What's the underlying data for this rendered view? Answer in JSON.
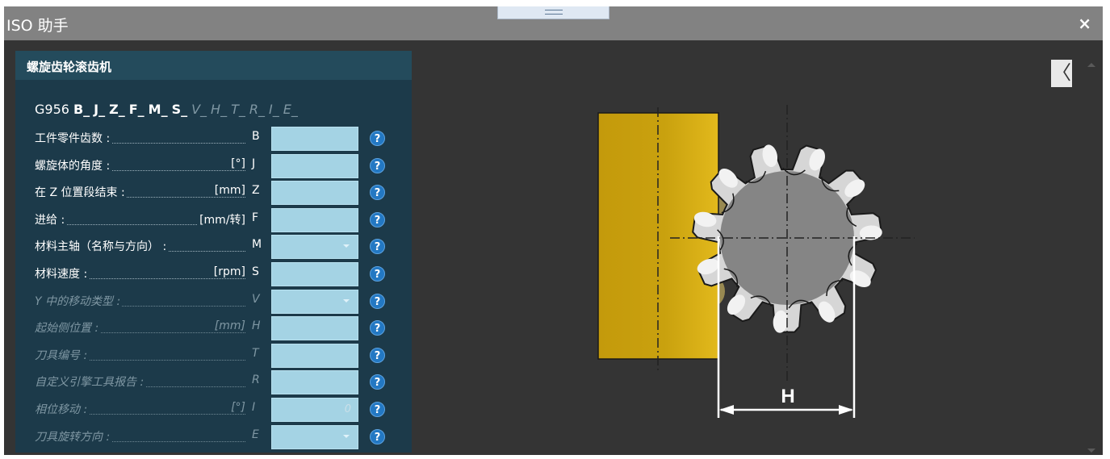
{
  "window": {
    "title": "ISO 助手",
    "close_symbol": "×"
  },
  "panel": {
    "title": "螺旋齿轮滚齿机",
    "code": {
      "prefix": "G956",
      "active": [
        "B_",
        "J_",
        "Z_",
        "F_",
        "M_",
        "S_"
      ],
      "inactive": [
        "V_",
        "H_",
        "T_",
        "R_",
        "I_",
        "E_"
      ]
    },
    "rows": [
      {
        "label": "工件零件齿数 :",
        "unit": "",
        "letter": "B",
        "type": "input",
        "value": "",
        "enabled": true
      },
      {
        "label": "螺旋体的角度 :",
        "unit": "[°]",
        "letter": "J",
        "type": "input",
        "value": "",
        "enabled": true
      },
      {
        "label": "在 Z 位置段结束 :",
        "unit": "[mm]",
        "letter": "Z",
        "type": "input",
        "value": "",
        "enabled": true
      },
      {
        "label": "进给 :",
        "unit": "[mm/转]",
        "letter": "F",
        "type": "input",
        "value": "",
        "enabled": true
      },
      {
        "label": "材料主轴（名称与方向） :",
        "unit": "",
        "letter": "M",
        "type": "select",
        "value": "",
        "enabled": true
      },
      {
        "label": "材料速度 :",
        "unit": "[rpm]",
        "letter": "S",
        "type": "input",
        "value": "",
        "enabled": true
      },
      {
        "label": "Y 中的移动类型 :",
        "unit": "",
        "letter": "V",
        "type": "select",
        "value": "",
        "enabled": false
      },
      {
        "label": "起始侧位置 :",
        "unit": "[mm]",
        "letter": "H",
        "type": "input",
        "value": "",
        "enabled": false
      },
      {
        "label": "刀具编号 :",
        "unit": "",
        "letter": "T",
        "type": "input",
        "value": "",
        "enabled": false
      },
      {
        "label": "自定义引擎工具报告 :",
        "unit": "",
        "letter": "R",
        "type": "input",
        "value": "",
        "enabled": false
      },
      {
        "label": "相位移动 :",
        "unit": "[°]",
        "letter": "I",
        "type": "input",
        "value": "0",
        "enabled": false
      },
      {
        "label": "刀具旋转方向 :",
        "unit": "",
        "letter": "E",
        "type": "select",
        "value": "",
        "enabled": false
      }
    ],
    "help_symbol": "?"
  },
  "collapse_symbol": "〈",
  "diagram": {
    "dimension_label": "H"
  },
  "colors": {
    "title_bar": "#828282",
    "window_bg": "#343434",
    "panel_bg": "#1c3a4a",
    "panel_header": "#244b5c",
    "field_bg": "#a4d3e4",
    "help_icon": "#2378c3",
    "workpiece": "#c9a10e",
    "gear": "#858585"
  },
  "icons": [
    "close-icon",
    "drag-handle-icon",
    "help-icon",
    "dropdown-arrow-icon",
    "collapse-icon",
    "scroll-up-icon",
    "scroll-down-icon"
  ]
}
